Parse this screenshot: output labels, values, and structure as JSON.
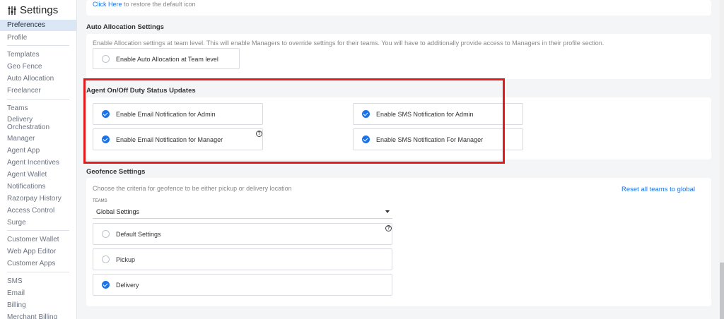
{
  "sidebar": {
    "title": "Settings",
    "items": [
      {
        "label": "Preferences",
        "active": true
      },
      {
        "label": "Profile"
      },
      {
        "label": "Templates"
      },
      {
        "label": "Geo Fence"
      },
      {
        "label": "Auto Allocation"
      },
      {
        "label": "Freelancer"
      },
      {
        "label": "Teams"
      },
      {
        "label": "Delivery Orchestration"
      },
      {
        "label": "Manager"
      },
      {
        "label": "Agent App"
      },
      {
        "label": "Agent Incentives"
      },
      {
        "label": "Agent Wallet"
      },
      {
        "label": "Notifications"
      },
      {
        "label": "Razorpay History"
      },
      {
        "label": "Access Control"
      },
      {
        "label": "Surge"
      },
      {
        "label": "Customer Wallet"
      },
      {
        "label": "Web App Editor"
      },
      {
        "label": "Customer Apps"
      },
      {
        "label": "SMS"
      },
      {
        "label": "Email"
      },
      {
        "label": "Billing"
      },
      {
        "label": "Merchant Billing"
      }
    ]
  },
  "restore": {
    "link": "Click Here",
    "text": " to restore the default icon"
  },
  "auto_allocation": {
    "title": "Auto Allocation Settings",
    "description": "Enable Allocation settings at team level. This will enable Managers to override settings for their teams. You will have to additionally provide access to Managers in their profile section.",
    "option": "Enable Auto Allocation at Team level"
  },
  "duty_status": {
    "title": "Agent On/Off Duty Status Updates",
    "email_admin": "Enable Email Notification for Admin",
    "email_manager": "Enable Email Notification for Manager",
    "sms_admin": "Enable SMS Notification for Admin",
    "sms_manager": "Enable SMS Notification For Manager",
    "help": "?"
  },
  "geofence": {
    "title": "Geofence Settings",
    "description": "Choose the criteria for geofence to be either pickup or delivery location",
    "reset_link": "Reset all teams to global",
    "teams_label": "TEAMS",
    "teams_value": "Global Settings",
    "options": [
      "Default Settings",
      "Pickup",
      "Delivery"
    ],
    "selected": "Delivery",
    "help": "?"
  },
  "colors": {
    "accent": "#1a73e8",
    "highlight": "#e31a1c"
  }
}
